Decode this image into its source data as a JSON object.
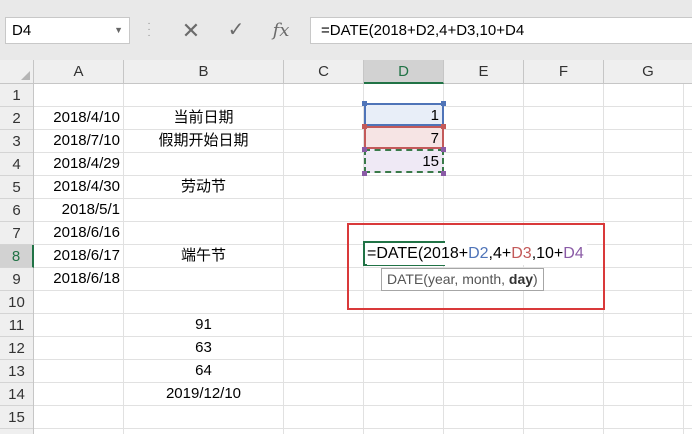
{
  "name_box": {
    "value": "D4"
  },
  "formula_bar": {
    "cancel_icon": "✕",
    "enter_icon": "✓",
    "fx_label": "fx",
    "formula": "=DATE(2018+D2,4+D3,10+D4"
  },
  "columns": [
    "A",
    "B",
    "C",
    "D",
    "E",
    "F",
    "G"
  ],
  "rows": [
    "1",
    "2",
    "3",
    "4",
    "5",
    "6",
    "7",
    "8",
    "9",
    "10",
    "11",
    "12",
    "13",
    "14",
    "15"
  ],
  "cells": {
    "A2": "2018/4/10",
    "A3": "2018/7/10",
    "A4": "2018/4/29",
    "A5": "2018/4/30",
    "A6": "2018/5/1",
    "A7": "2018/6/16",
    "A8": "2018/6/17",
    "A9": "2018/6/18",
    "B2": "当前日期",
    "B3": "假期开始日期",
    "B5": "劳动节",
    "B8": "端午节",
    "B11": "91",
    "B12": "63",
    "B13": "64",
    "B14": "2019/12/10",
    "D2": "1",
    "D3": "7",
    "D4": "15"
  },
  "editing": {
    "cell": "D8",
    "parts": [
      "=DATE(2018+",
      "D2",
      ",4+",
      "D3",
      ",10+",
      "D4"
    ]
  },
  "tooltip": {
    "func": "DATE(",
    "args": "year, month, ",
    "current_arg": "day",
    "close": ")"
  },
  "colors": {
    "accent": "#217346",
    "ref_d2": "#4f74b8",
    "ref_d3": "#c35a5a",
    "ref_d4": "#8a5ba6",
    "highlight_box": "#d9393a"
  }
}
